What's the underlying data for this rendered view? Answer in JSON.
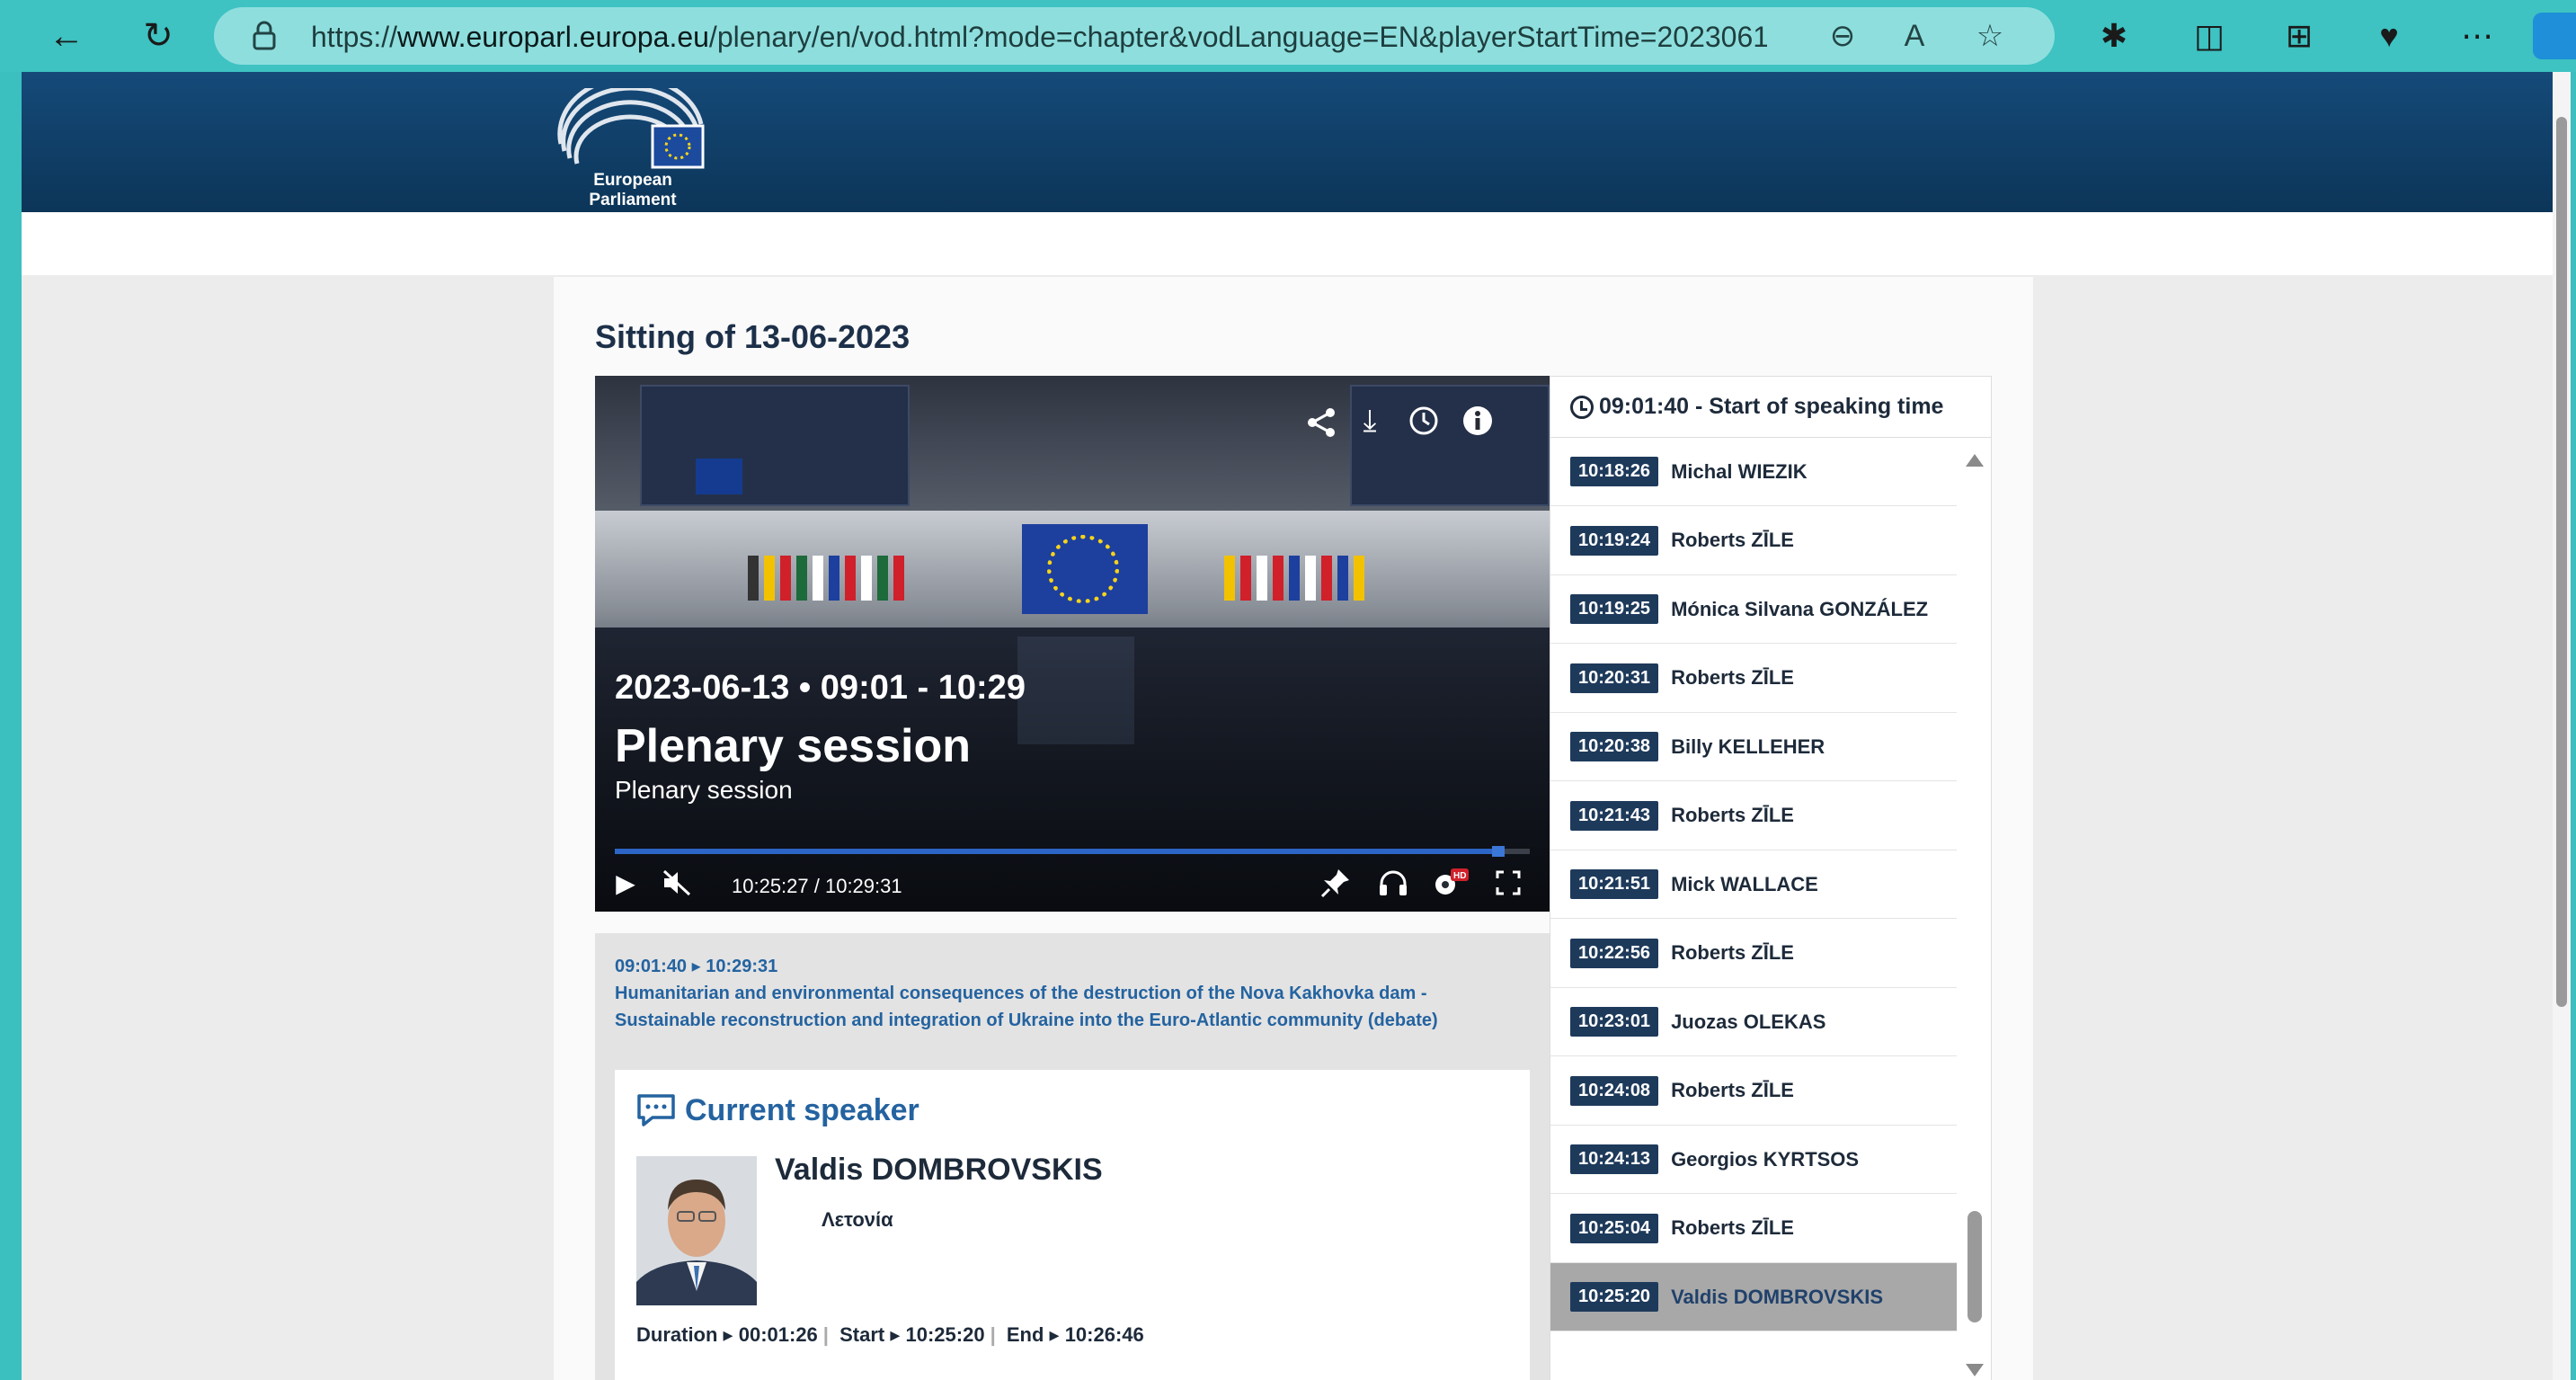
{
  "browser": {
    "url_prefix": "https://",
    "url_host": "www.europarl.europa.eu",
    "url_rest": "/plenary/en/vod.html?mode=chapter&vodLanguage=EN&playerStartTime=20230613-..."
  },
  "header": {
    "logo_text": "European Parliament"
  },
  "sitting": {
    "title": "Sitting of 13-06-2023"
  },
  "video": {
    "date_line": "2023-06-13 • 09:01 - 10:29",
    "title": "Plenary session",
    "subtitle": "Plenary session",
    "time_display": "10:25:27 / 10:29:31",
    "progress_fraction": 0.959
  },
  "chapters": {
    "header": "09:01:40 - Start of speaking time",
    "items": [
      {
        "time": "10:18:26",
        "name": "Michal WIEZIK"
      },
      {
        "time": "10:19:24",
        "name": "Roberts ZĪLE"
      },
      {
        "time": "10:19:25",
        "name": "Mónica Silvana GONZÁLEZ"
      },
      {
        "time": "10:20:31",
        "name": "Roberts ZĪLE"
      },
      {
        "time": "10:20:38",
        "name": "Billy KELLEHER"
      },
      {
        "time": "10:21:43",
        "name": "Roberts ZĪLE"
      },
      {
        "time": "10:21:51",
        "name": "Mick WALLACE"
      },
      {
        "time": "10:22:56",
        "name": "Roberts ZĪLE"
      },
      {
        "time": "10:23:01",
        "name": "Juozas OLEKAS"
      },
      {
        "time": "10:24:08",
        "name": "Roberts ZĪLE"
      },
      {
        "time": "10:24:13",
        "name": "Georgios KYRTSOS"
      },
      {
        "time": "10:25:04",
        "name": "Roberts ZĪLE"
      },
      {
        "time": "10:25:20",
        "name": "Valdis DOMBROVSKIS"
      }
    ],
    "active_index": 12
  },
  "debate": {
    "time_range": "09:01:40 ▸ 10:29:31",
    "title": "Humanitarian and environmental consequences of the destruction of the Nova Kakhovka dam - Sustainable reconstruction and integration of Ukraine into the Euro-Atlantic community (debate)"
  },
  "current_speaker": {
    "heading": "Current speaker",
    "name": "Valdis DOMBROVSKIS",
    "country": "Λετονία",
    "duration_label": "Duration ▸",
    "duration": "00:01:26",
    "start_label": "Start ▸",
    "start": "10:25:20",
    "end_label": "End ▸",
    "end": "10:26:46"
  },
  "colors": {
    "header_bg": "#154a79",
    "accent": "#2463a0",
    "timestamp_bg": "#1e3a5b",
    "browser": "#3ec2c2"
  }
}
